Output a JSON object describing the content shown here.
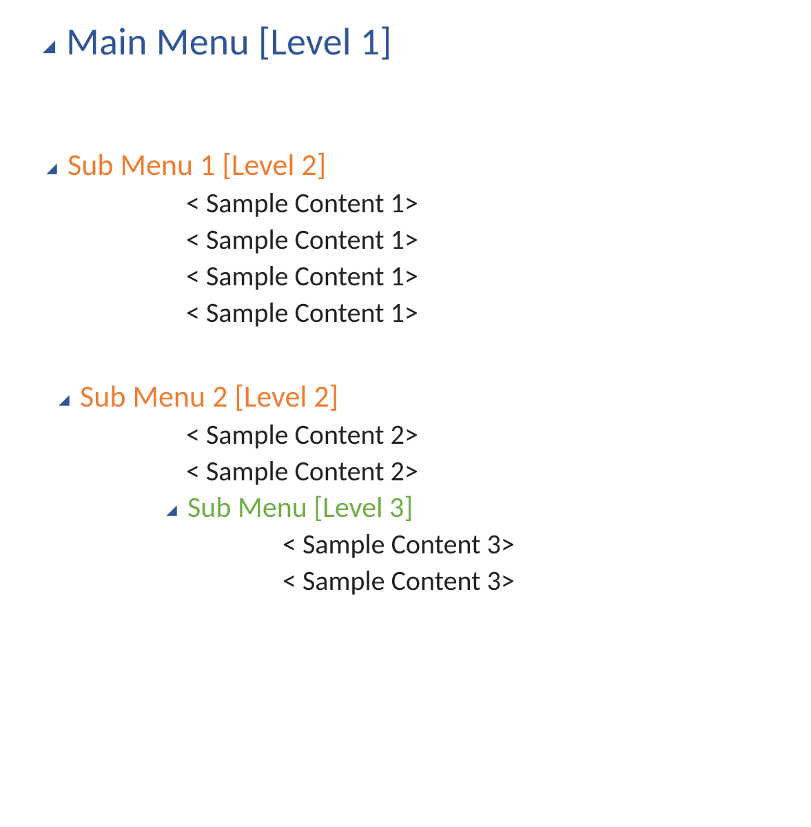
{
  "colors": {
    "heading1": "#2F5596",
    "heading2": "#ED7D31",
    "heading3": "#70AD47",
    "collapse_triangle": "#2F5596",
    "body": "#222222"
  },
  "outline": {
    "level1": {
      "title": "Main Menu [Level 1]"
    },
    "level2a": {
      "title": "Sub Menu 1 [Level 2]",
      "items": [
        "< Sample Content 1>",
        "< Sample Content 1>",
        "< Sample Content 1>",
        "< Sample Content 1>"
      ]
    },
    "level2b": {
      "title": "Sub Menu 2 [Level 2]",
      "items": [
        "< Sample Content 2>",
        "< Sample Content 2>"
      ],
      "level3": {
        "title": "Sub Menu [Level 3]",
        "items": [
          "< Sample Content 3>",
          "< Sample Content 3>"
        ]
      }
    }
  }
}
